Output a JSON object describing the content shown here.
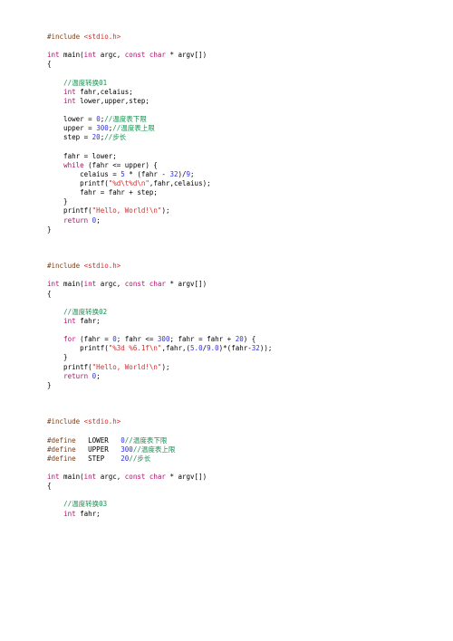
{
  "lines": [
    [
      {
        "cls": "tk-pp",
        "t": "#include "
      },
      {
        "cls": "tk-str",
        "t": "<stdio.h>"
      }
    ],
    [],
    [
      {
        "cls": "tk-kw",
        "t": "int"
      },
      {
        "cls": "tk-plain",
        "t": " main("
      },
      {
        "cls": "tk-kw",
        "t": "int"
      },
      {
        "cls": "tk-plain",
        "t": " argc, "
      },
      {
        "cls": "tk-kw",
        "t": "const"
      },
      {
        "cls": "tk-plain",
        "t": " "
      },
      {
        "cls": "tk-kw",
        "t": "char"
      },
      {
        "cls": "tk-plain",
        "t": " * argv[])"
      }
    ],
    [
      {
        "cls": "tk-plain",
        "t": "{"
      }
    ],
    [],
    [
      {
        "cls": "tk-plain",
        "t": "    "
      },
      {
        "cls": "tk-cmt",
        "t": "//温度转换01"
      }
    ],
    [
      {
        "cls": "tk-plain",
        "t": "    "
      },
      {
        "cls": "tk-kw",
        "t": "int"
      },
      {
        "cls": "tk-plain",
        "t": " fahr,celaius;"
      }
    ],
    [
      {
        "cls": "tk-plain",
        "t": "    "
      },
      {
        "cls": "tk-kw",
        "t": "int"
      },
      {
        "cls": "tk-plain",
        "t": " lower,upper,step;"
      }
    ],
    [],
    [
      {
        "cls": "tk-plain",
        "t": "    lower = "
      },
      {
        "cls": "tk-num",
        "t": "0"
      },
      {
        "cls": "tk-plain",
        "t": ";"
      },
      {
        "cls": "tk-cmt",
        "t": "//温度表下限"
      }
    ],
    [
      {
        "cls": "tk-plain",
        "t": "    upper = "
      },
      {
        "cls": "tk-num",
        "t": "300"
      },
      {
        "cls": "tk-plain",
        "t": ";"
      },
      {
        "cls": "tk-cmt",
        "t": "//温度表上限"
      }
    ],
    [
      {
        "cls": "tk-plain",
        "t": "    step = "
      },
      {
        "cls": "tk-num",
        "t": "20"
      },
      {
        "cls": "tk-plain",
        "t": ";"
      },
      {
        "cls": "tk-cmt",
        "t": "//步长"
      }
    ],
    [],
    [
      {
        "cls": "tk-plain",
        "t": "    fahr = lower;"
      }
    ],
    [
      {
        "cls": "tk-plain",
        "t": "    "
      },
      {
        "cls": "tk-kw",
        "t": "while"
      },
      {
        "cls": "tk-plain",
        "t": " (fahr <= upper) {"
      }
    ],
    [
      {
        "cls": "tk-plain",
        "t": "        celaius = "
      },
      {
        "cls": "tk-num",
        "t": "5"
      },
      {
        "cls": "tk-plain",
        "t": " * (fahr - "
      },
      {
        "cls": "tk-num",
        "t": "32"
      },
      {
        "cls": "tk-plain",
        "t": ")/"
      },
      {
        "cls": "tk-num",
        "t": "9"
      },
      {
        "cls": "tk-plain",
        "t": ";"
      }
    ],
    [
      {
        "cls": "tk-plain",
        "t": "        printf("
      },
      {
        "cls": "tk-str",
        "t": "\"%d\\t%d\\n\""
      },
      {
        "cls": "tk-plain",
        "t": ",fahr,celaius);"
      }
    ],
    [
      {
        "cls": "tk-plain",
        "t": "        fahr = fahr + step;"
      }
    ],
    [
      {
        "cls": "tk-plain",
        "t": "    }"
      }
    ],
    [
      {
        "cls": "tk-plain",
        "t": "    printf("
      },
      {
        "cls": "tk-str",
        "t": "\"Hello, World!\\n\""
      },
      {
        "cls": "tk-plain",
        "t": ");"
      }
    ],
    [
      {
        "cls": "tk-plain",
        "t": "    "
      },
      {
        "cls": "tk-kw",
        "t": "return"
      },
      {
        "cls": "tk-plain",
        "t": " "
      },
      {
        "cls": "tk-num",
        "t": "0"
      },
      {
        "cls": "tk-plain",
        "t": ";"
      }
    ],
    [
      {
        "cls": "tk-plain",
        "t": "}"
      }
    ],
    [],
    [],
    [],
    [
      {
        "cls": "tk-pp",
        "t": "#include "
      },
      {
        "cls": "tk-str",
        "t": "<stdio.h>"
      }
    ],
    [],
    [
      {
        "cls": "tk-kw",
        "t": "int"
      },
      {
        "cls": "tk-plain",
        "t": " main("
      },
      {
        "cls": "tk-kw",
        "t": "int"
      },
      {
        "cls": "tk-plain",
        "t": " argc, "
      },
      {
        "cls": "tk-kw",
        "t": "const"
      },
      {
        "cls": "tk-plain",
        "t": " "
      },
      {
        "cls": "tk-kw",
        "t": "char"
      },
      {
        "cls": "tk-plain",
        "t": " * argv[])"
      }
    ],
    [
      {
        "cls": "tk-plain",
        "t": "{"
      }
    ],
    [],
    [
      {
        "cls": "tk-plain",
        "t": "    "
      },
      {
        "cls": "tk-cmt",
        "t": "//温度转换02"
      }
    ],
    [
      {
        "cls": "tk-plain",
        "t": "    "
      },
      {
        "cls": "tk-kw",
        "t": "int"
      },
      {
        "cls": "tk-plain",
        "t": " fahr;"
      }
    ],
    [],
    [
      {
        "cls": "tk-plain",
        "t": "    "
      },
      {
        "cls": "tk-kw",
        "t": "for"
      },
      {
        "cls": "tk-plain",
        "t": " (fahr = "
      },
      {
        "cls": "tk-num",
        "t": "0"
      },
      {
        "cls": "tk-plain",
        "t": "; fahr <= "
      },
      {
        "cls": "tk-num",
        "t": "300"
      },
      {
        "cls": "tk-plain",
        "t": "; fahr = fahr + "
      },
      {
        "cls": "tk-num",
        "t": "20"
      },
      {
        "cls": "tk-plain",
        "t": ") {"
      }
    ],
    [
      {
        "cls": "tk-plain",
        "t": "        printf("
      },
      {
        "cls": "tk-str",
        "t": "\"%3d %6.1f\\n\""
      },
      {
        "cls": "tk-plain",
        "t": ",fahr,("
      },
      {
        "cls": "tk-num",
        "t": "5.0"
      },
      {
        "cls": "tk-plain",
        "t": "/"
      },
      {
        "cls": "tk-num",
        "t": "9.0"
      },
      {
        "cls": "tk-plain",
        "t": ")*(fahr-"
      },
      {
        "cls": "tk-num",
        "t": "32"
      },
      {
        "cls": "tk-plain",
        "t": "));"
      }
    ],
    [
      {
        "cls": "tk-plain",
        "t": "    }"
      }
    ],
    [
      {
        "cls": "tk-plain",
        "t": "    printf("
      },
      {
        "cls": "tk-str",
        "t": "\"Hello, World!\\n\""
      },
      {
        "cls": "tk-plain",
        "t": ");"
      }
    ],
    [
      {
        "cls": "tk-plain",
        "t": "    "
      },
      {
        "cls": "tk-kw",
        "t": "return"
      },
      {
        "cls": "tk-plain",
        "t": " "
      },
      {
        "cls": "tk-num",
        "t": "0"
      },
      {
        "cls": "tk-plain",
        "t": ";"
      }
    ],
    [
      {
        "cls": "tk-plain",
        "t": "}"
      }
    ],
    [],
    [],
    [],
    [
      {
        "cls": "tk-pp",
        "t": "#include "
      },
      {
        "cls": "tk-str",
        "t": "<stdio.h>"
      }
    ],
    [],
    [
      {
        "cls": "tk-pp",
        "t": "#define"
      },
      {
        "cls": "tk-plain",
        "t": "   LOWER   "
      },
      {
        "cls": "tk-num",
        "t": "0"
      },
      {
        "cls": "tk-cmt",
        "t": "//温度表下限"
      }
    ],
    [
      {
        "cls": "tk-pp",
        "t": "#define"
      },
      {
        "cls": "tk-plain",
        "t": "   UPPER   "
      },
      {
        "cls": "tk-num",
        "t": "300"
      },
      {
        "cls": "tk-cmt",
        "t": "//温度表上限"
      }
    ],
    [
      {
        "cls": "tk-pp",
        "t": "#define"
      },
      {
        "cls": "tk-plain",
        "t": "   STEP    "
      },
      {
        "cls": "tk-num",
        "t": "20"
      },
      {
        "cls": "tk-cmt",
        "t": "//步长"
      }
    ],
    [],
    [
      {
        "cls": "tk-kw",
        "t": "int"
      },
      {
        "cls": "tk-plain",
        "t": " main("
      },
      {
        "cls": "tk-kw",
        "t": "int"
      },
      {
        "cls": "tk-plain",
        "t": " argc, "
      },
      {
        "cls": "tk-kw",
        "t": "const"
      },
      {
        "cls": "tk-plain",
        "t": " "
      },
      {
        "cls": "tk-kw",
        "t": "char"
      },
      {
        "cls": "tk-plain",
        "t": " * argv[])"
      }
    ],
    [
      {
        "cls": "tk-plain",
        "t": "{"
      }
    ],
    [],
    [
      {
        "cls": "tk-plain",
        "t": "    "
      },
      {
        "cls": "tk-cmt",
        "t": "//温度转换03"
      }
    ],
    [
      {
        "cls": "tk-plain",
        "t": "    "
      },
      {
        "cls": "tk-kw",
        "t": "int"
      },
      {
        "cls": "tk-plain",
        "t": " fahr;"
      }
    ]
  ]
}
